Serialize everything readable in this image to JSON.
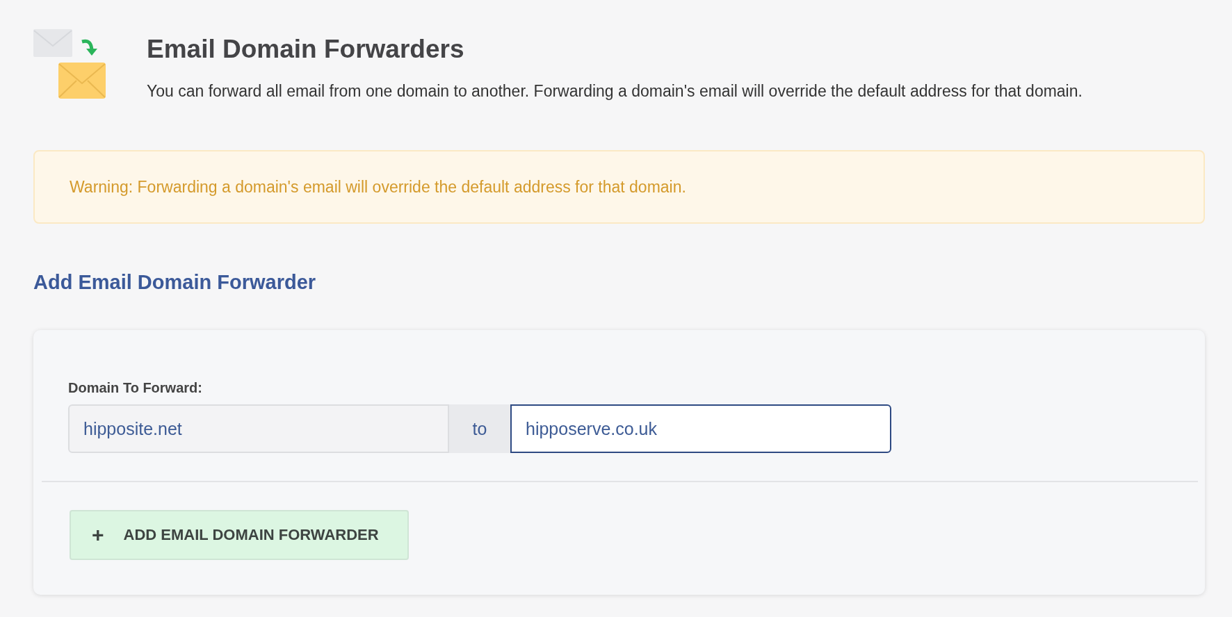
{
  "header": {
    "title": "Email Domain Forwarders",
    "description": "You can forward all email from one domain to another. Forwarding a domain's email will override the default address for that domain."
  },
  "alert": {
    "kind": "warning",
    "text": "Warning: Forwarding a domain's email will override the default address for that domain."
  },
  "section": {
    "title": "Add Email Domain Forwarder"
  },
  "form": {
    "label": "Domain To Forward:",
    "source": {
      "value": "hipposite.net",
      "disabled": true,
      "focused": false
    },
    "separator": "to",
    "target": {
      "value": "hipposerve.co.uk",
      "focused": true
    },
    "button": {
      "icon": "+",
      "label": "ADD EMAIL DOMAIN FORWARDER"
    }
  }
}
